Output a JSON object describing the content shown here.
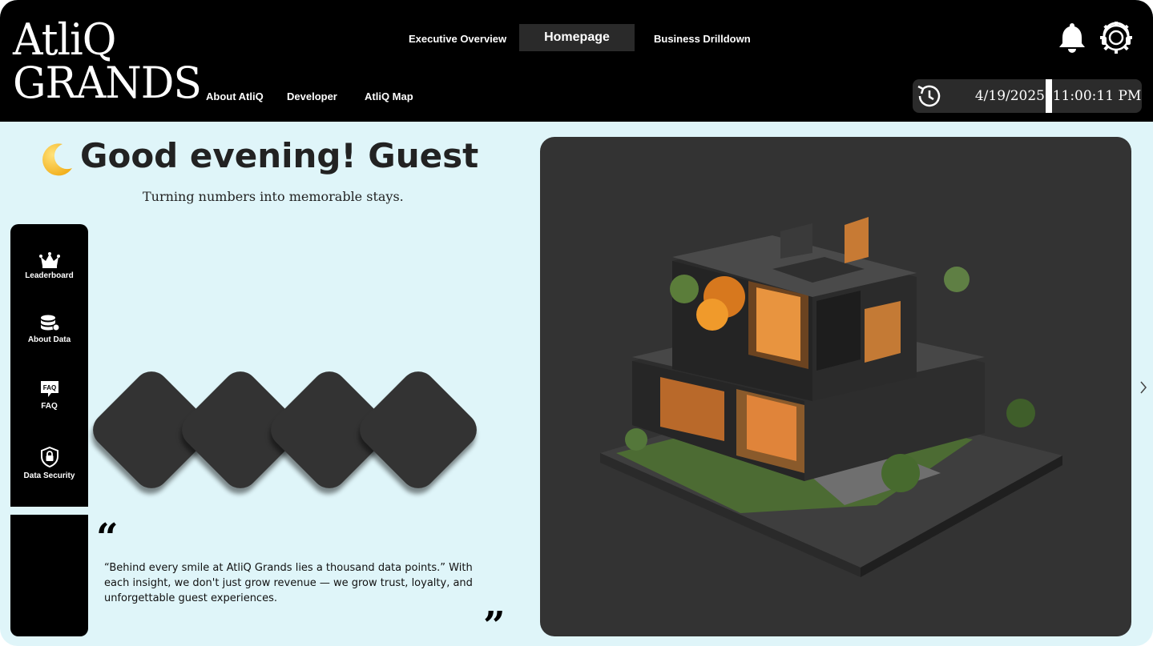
{
  "brand": {
    "line1": "AtliQ",
    "line2": "GRANDS"
  },
  "nav": {
    "top": {
      "left": "Executive Overview",
      "active": "Homepage",
      "right": "Business Drilldown"
    },
    "sub": [
      "About AtliQ",
      "Developer",
      "AtliQ Map"
    ]
  },
  "status": {
    "date": "4/19/2025",
    "time": "11:00:11 PM"
  },
  "greeting": {
    "title": "Good evening! Guest",
    "tagline": "Turning numbers into memorable stays."
  },
  "sidebar": {
    "items": [
      "Leaderboard",
      "About Data",
      "FAQ",
      "Data Security"
    ],
    "faq_icon_text": "FAQ"
  },
  "quote": {
    "open": "“",
    "close": "”",
    "text": "“Behind every smile at AtliQ Grands lies a thousand data points.” With each insight, we don't just grow revenue — we grow trust, loyalty, and unforgettable guest experiences."
  },
  "icons": [
    "moon-icon",
    "bell-icon",
    "gear-headset-icon",
    "refresh-clock-icon",
    "crown-icon",
    "database-icon",
    "faq-icon",
    "shield-lock-icon",
    "chevron-right-icon"
  ],
  "colors": {
    "background": "#dff5f9",
    "header": "#000000",
    "panel": "#333333",
    "accent_wood": "#e0843a"
  }
}
